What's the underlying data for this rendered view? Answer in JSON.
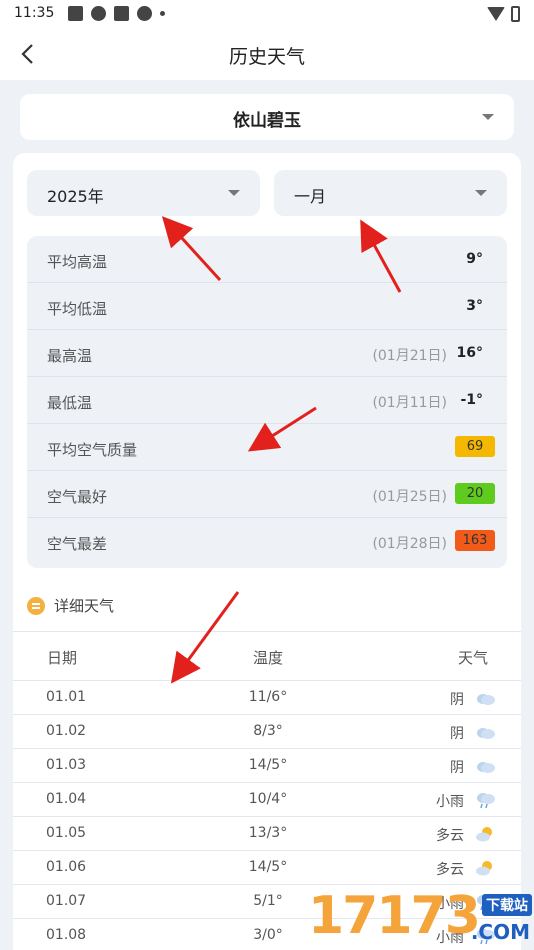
{
  "status": {
    "time": "11:35"
  },
  "header": {
    "title": "历史天气"
  },
  "location": {
    "name": "依山碧玉"
  },
  "filters": {
    "year": "2025年",
    "month": "一月"
  },
  "stats": [
    {
      "label": "平均高温",
      "date": "",
      "value": "9°",
      "badge": null
    },
    {
      "label": "平均低温",
      "date": "",
      "value": "3°",
      "badge": null
    },
    {
      "label": "最高温",
      "date": "(01月21日)",
      "value": "16°",
      "badge": null
    },
    {
      "label": "最低温",
      "date": "(01月11日)",
      "value": "-1°",
      "badge": null
    },
    {
      "label": "平均空气质量",
      "date": "",
      "value": "",
      "badge": "69",
      "badge_color": "#f5b800"
    },
    {
      "label": "空气最好",
      "date": "(01月25日)",
      "value": "",
      "badge": "20",
      "badge_color": "#5ecb1e"
    },
    {
      "label": "空气最差",
      "date": "(01月28日)",
      "value": "",
      "badge": "163",
      "badge_color": "#f25a19"
    }
  ],
  "detail": {
    "title": "详细天气",
    "columns": [
      "日期",
      "温度",
      "天气"
    ],
    "rows": [
      {
        "date": "01.01",
        "temp": "11/6°",
        "weather": "阴",
        "icon": "cloudy-icon"
      },
      {
        "date": "01.02",
        "temp": "8/3°",
        "weather": "阴",
        "icon": "cloudy-icon"
      },
      {
        "date": "01.03",
        "temp": "14/5°",
        "weather": "阴",
        "icon": "cloudy-icon"
      },
      {
        "date": "01.04",
        "temp": "10/4°",
        "weather": "小雨",
        "icon": "light-rain-icon"
      },
      {
        "date": "01.05",
        "temp": "13/3°",
        "weather": "多云",
        "icon": "partly-cloudy-icon"
      },
      {
        "date": "01.06",
        "temp": "14/5°",
        "weather": "多云",
        "icon": "partly-cloudy-icon"
      },
      {
        "date": "01.07",
        "temp": "5/1°",
        "weather": "小雨",
        "icon": "light-rain-icon"
      },
      {
        "date": "01.08",
        "temp": "3/0°",
        "weather": "小雨",
        "icon": "light-rain-icon"
      }
    ]
  },
  "watermark": {
    "digits": "17173",
    "tag": "下载站",
    "suffix": ".COM"
  }
}
